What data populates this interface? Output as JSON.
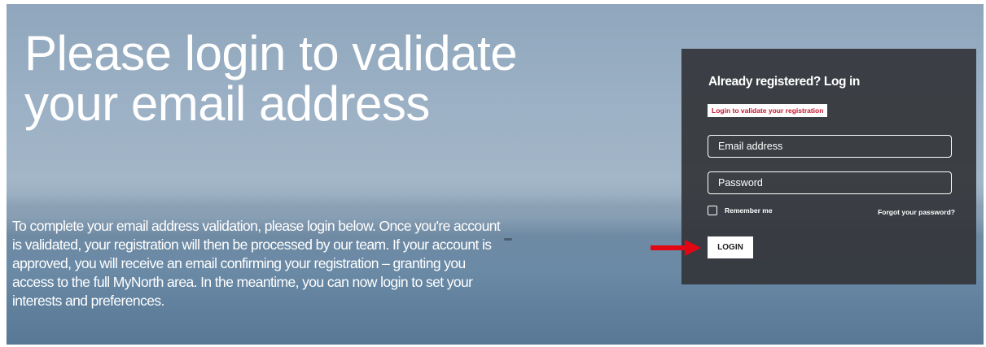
{
  "hero": {
    "title": "Please login to validate your email address",
    "text": "To complete your email address validation, please login below. Once you're account is validated, your registration will then be processed by our team. If your account is approved, you will receive an email confirming your registration – granting you access to the full MyNorth area. In the meantime, you can now login to set your interests and preferences."
  },
  "login_panel": {
    "heading": "Already registered? Log in",
    "notice": "Login to validate your registration",
    "email_placeholder": "Email address",
    "password_placeholder": "Password",
    "remember_label": "Remember me",
    "forgot_label": "Forgot your password?",
    "login_label": "LOGIN"
  },
  "icons": {
    "arrow": "right-arrow-icon",
    "arrow_color": "#e30613",
    "checkbox": "checkbox-icon"
  },
  "colors": {
    "notice_text": "#c3162f",
    "panel_bg": "#34363a"
  }
}
